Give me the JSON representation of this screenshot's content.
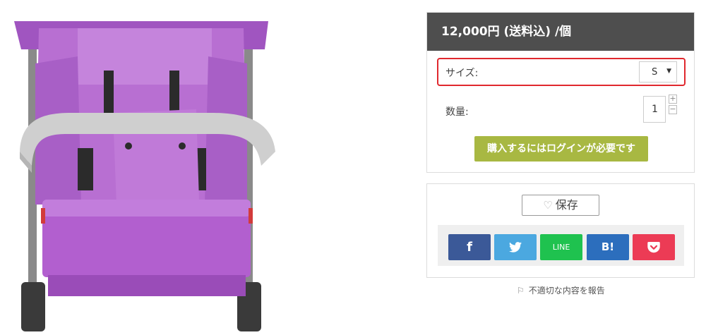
{
  "product": {
    "price_label": "12,000円 (送料込) /個",
    "size_label": "サイズ:",
    "size_value": "S",
    "quantity_label": "数量:",
    "quantity_value": "1",
    "plus_symbol": "+",
    "minus_symbol": "−",
    "login_button": "購入するにはログインが必要です"
  },
  "share": {
    "save_label": "保存",
    "facebook_label": "f",
    "twitter_label": "twitter-icon",
    "line_label": "LINE",
    "hatena_label": "B!",
    "pocket_label": "pocket-icon"
  },
  "report_link": "不適切な内容を報告",
  "colors": {
    "price_bar": "#4e4e4e",
    "login_button": "#a8b842",
    "highlight_border": "#e0282e",
    "facebook": "#3b5998",
    "twitter": "#4ba8e0",
    "line": "#1fc24f",
    "hatena": "#2c6ebd",
    "pocket": "#ec3b55",
    "stroller_fabric": "#b86fd2"
  }
}
